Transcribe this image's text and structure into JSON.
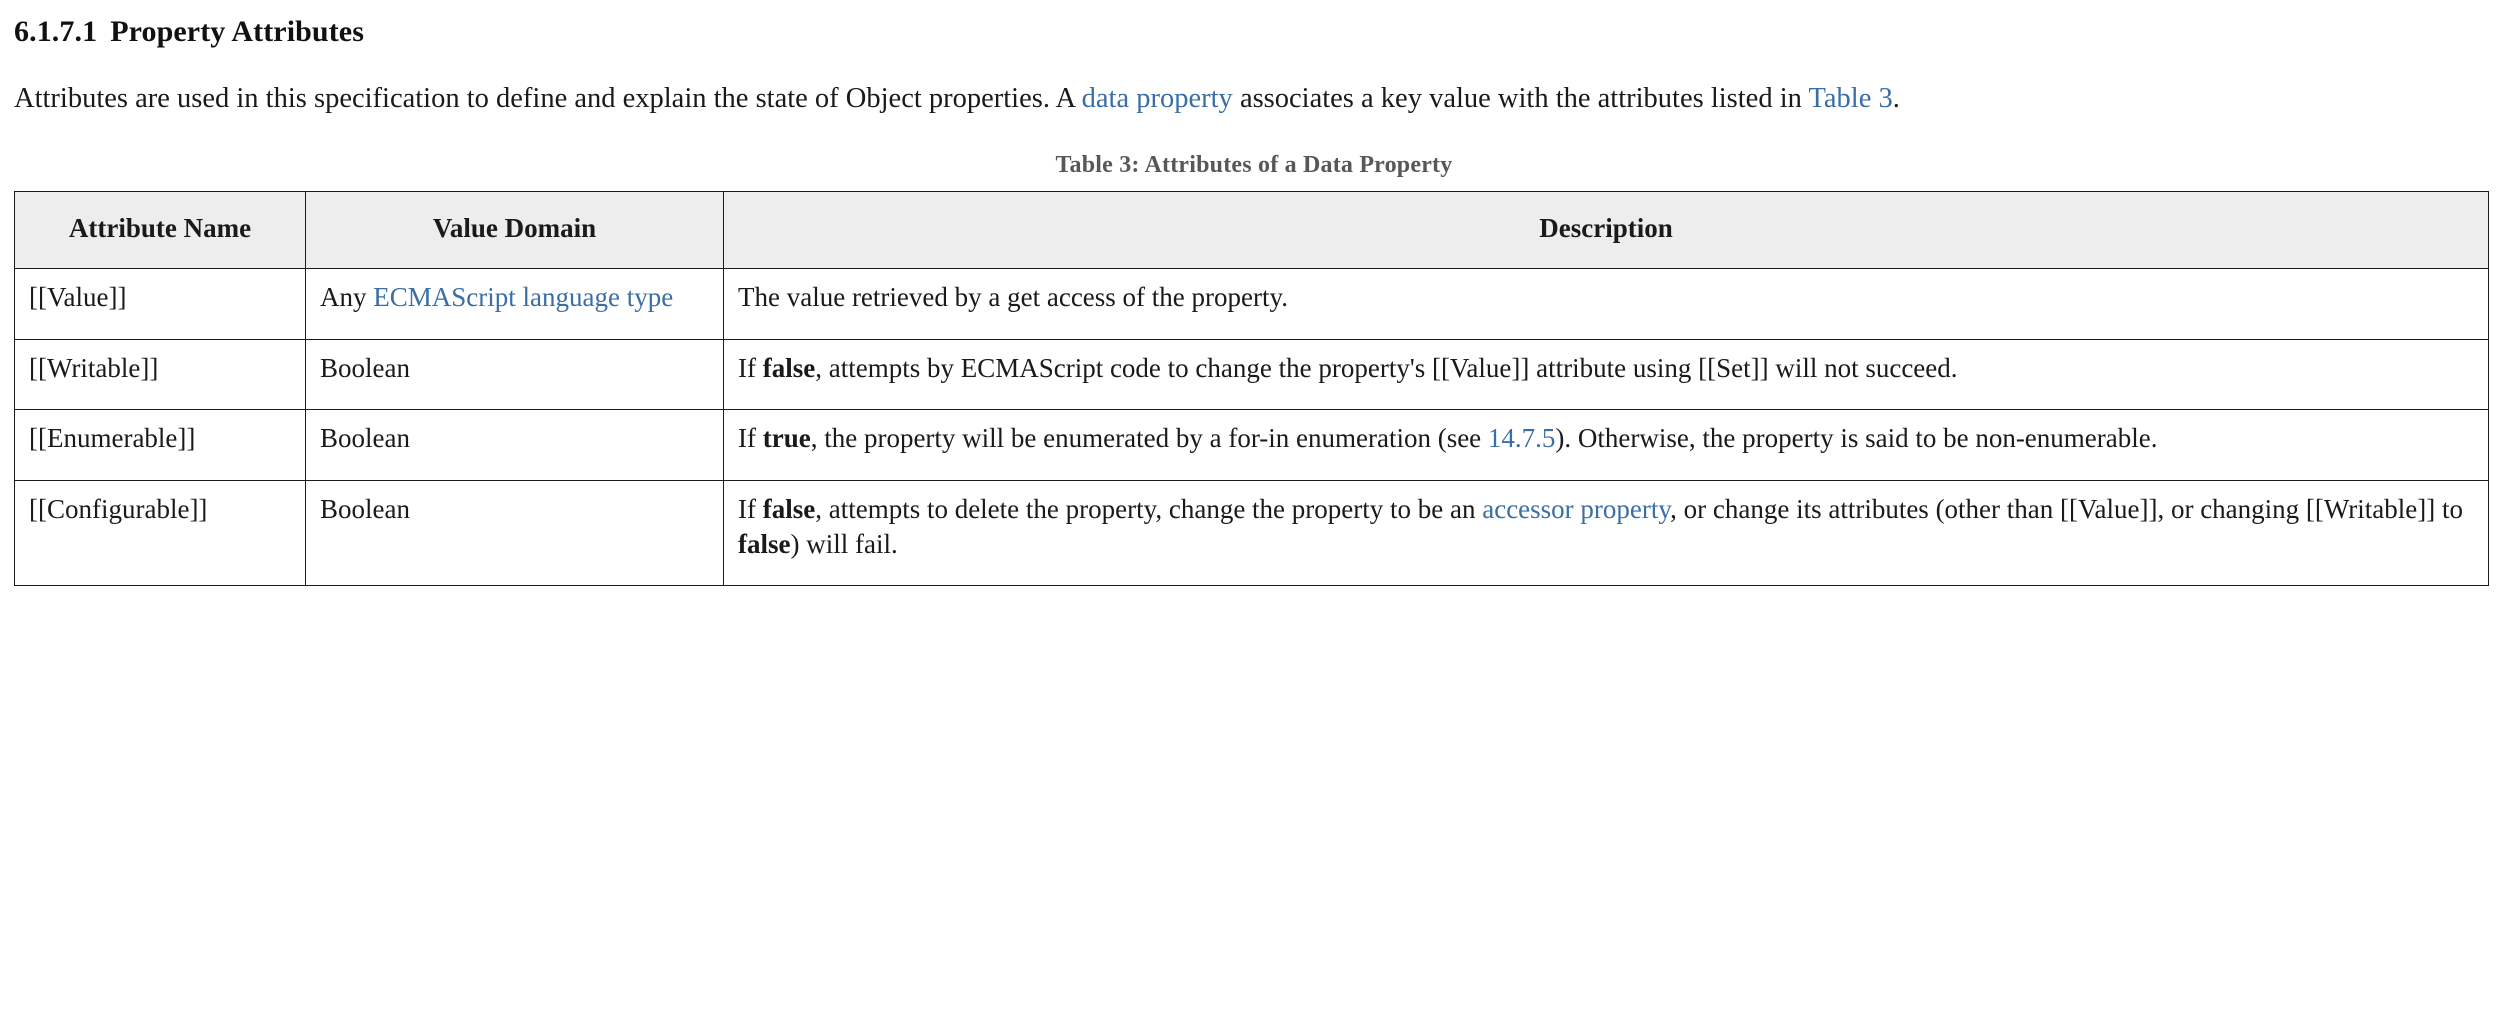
{
  "section": {
    "number": "6.1.7.1",
    "title": "Property Attributes"
  },
  "intro": {
    "part1": "Attributes are used in this specification to define and explain the state of Object properties. A ",
    "link_data_property": "data property",
    "part2": " associates a key value with the attributes listed in ",
    "link_table3": "Table 3",
    "part3": "."
  },
  "table": {
    "caption": "Table 3: Attributes of a Data Property",
    "headers": {
      "attribute_name": "Attribute Name",
      "value_domain": "Value Domain",
      "description": "Description"
    },
    "rows": [
      {
        "attribute": "[[Value]]",
        "domain_prefix": "Any ",
        "domain_link": "ECMAScript language type",
        "domain_suffix": "",
        "description_parts": [
          {
            "t": "The value retrieved by a get access of the property.",
            "s": "plain"
          }
        ]
      },
      {
        "attribute": "[[Writable]]",
        "domain_prefix": "Boolean",
        "domain_link": "",
        "domain_suffix": "",
        "description_parts": [
          {
            "t": "If ",
            "s": "plain"
          },
          {
            "t": "false",
            "s": "bold"
          },
          {
            "t": ", attempts by ECMAScript code to change the property's [[Value]] attribute using [[Set]] will not succeed.",
            "s": "plain"
          }
        ]
      },
      {
        "attribute": "[[Enumerable]]",
        "domain_prefix": "Boolean",
        "domain_link": "",
        "domain_suffix": "",
        "description_parts": [
          {
            "t": "If ",
            "s": "plain"
          },
          {
            "t": "true",
            "s": "bold"
          },
          {
            "t": ", the property will be enumerated by a for-in enumeration (see ",
            "s": "plain"
          },
          {
            "t": "14.7.5",
            "s": "link"
          },
          {
            "t": "). Otherwise, the property is said to be non-enumerable.",
            "s": "plain"
          }
        ]
      },
      {
        "attribute": "[[Configurable]]",
        "domain_prefix": "Boolean",
        "domain_link": "",
        "domain_suffix": "",
        "description_parts": [
          {
            "t": "If ",
            "s": "plain"
          },
          {
            "t": "false",
            "s": "bold"
          },
          {
            "t": ", attempts to delete the property, change the property to be an ",
            "s": "plain"
          },
          {
            "t": "accessor property",
            "s": "link"
          },
          {
            "t": ", or change its attributes (other than [[Value]], or changing [[Writable]] to ",
            "s": "plain"
          },
          {
            "t": "false",
            "s": "bold"
          },
          {
            "t": ") will fail.",
            "s": "plain"
          }
        ]
      }
    ]
  },
  "colors": {
    "link": "#3a6ea5",
    "header_bg": "#ededed",
    "caption": "#585858",
    "border": "#1b1b1b",
    "text": "#1a1a1a"
  }
}
